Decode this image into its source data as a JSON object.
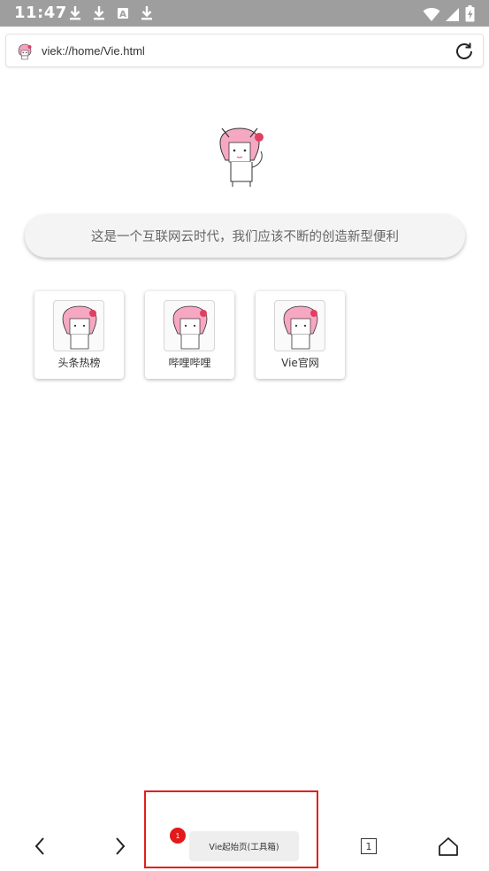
{
  "status_bar": {
    "time": "11:47",
    "icons_left": [
      "download-icon",
      "download-icon",
      "accessibility-icon",
      "download-icon"
    ],
    "icons_right": [
      "wifi-icon",
      "signal-icon",
      "battery-charging-icon"
    ],
    "background": "#9e9e9e"
  },
  "address_bar": {
    "url": "viek://home/Vie.html",
    "favicon": "anime-girl-favicon",
    "reload_icon": "reload-icon"
  },
  "logo": {
    "icon": "anime-girl-cat-logo"
  },
  "search": {
    "text": "这是一个互联网云时代，我们应该不断的创造新型便利"
  },
  "tiles": [
    {
      "label": "头条热榜",
      "icon": "anime-girl-icon"
    },
    {
      "label": "哔哩哔哩",
      "icon": "anime-girl-icon"
    },
    {
      "label": "Vie官网",
      "icon": "anime-girl-icon"
    }
  ],
  "bottom_nav": {
    "back_icon": "chevron-left-icon",
    "forward_icon": "chevron-right-icon",
    "current_tab_label": "Vie起始页(工具箱)",
    "badge_count": "1",
    "tab_count": "1",
    "home_icon": "home-icon"
  },
  "colors": {
    "accent_red": "#e0201b",
    "badge_red": "#e3191a",
    "pill_background": "#f4f4f4"
  }
}
